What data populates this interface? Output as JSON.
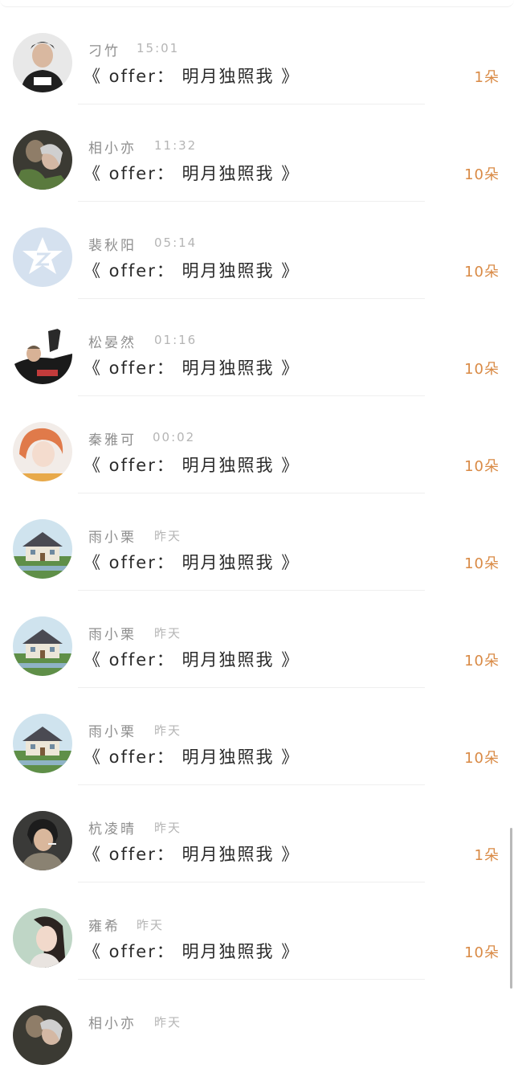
{
  "messages": [
    {
      "name": "刁竹",
      "time": "15:01",
      "title": "《 offer： 明月独照我 》",
      "count": "1朵",
      "avatar": "man-black-tank-icon"
    },
    {
      "name": "相小亦",
      "time": "11:32",
      "title": "《 offer： 明月独照我 》",
      "count": "10朵",
      "avatar": "couple-photo-icon"
    },
    {
      "name": "裴秋阳",
      "time": "05:14",
      "title": "《 offer： 明月独照我 》",
      "count": "10朵",
      "avatar": "qzone-default-icon"
    },
    {
      "name": "松晏然",
      "time": "01:16",
      "title": "《 offer： 明月独照我 》",
      "count": "10朵",
      "avatar": "man-car-icon"
    },
    {
      "name": "秦雅可",
      "time": "00:02",
      "title": "《 offer： 明月独照我 》",
      "count": "10朵",
      "avatar": "girl-light-icon"
    },
    {
      "name": "雨小栗",
      "time": "昨天",
      "title": "《 offer： 明月独照我 》",
      "count": "10朵",
      "avatar": "house-garden-icon"
    },
    {
      "name": "雨小栗",
      "time": "昨天",
      "title": "《 offer： 明月独照我 》",
      "count": "10朵",
      "avatar": "house-garden-icon"
    },
    {
      "name": "雨小栗",
      "time": "昨天",
      "title": "《 offer： 明月独照我 》",
      "count": "10朵",
      "avatar": "house-garden-icon"
    },
    {
      "name": "杭凌晴",
      "time": "昨天",
      "title": "《 offer： 明月独照我 》",
      "count": "1朵",
      "avatar": "person-smoking-icon"
    },
    {
      "name": "雍希",
      "time": "昨天",
      "title": "《 offer： 明月独照我 》",
      "count": "10朵",
      "avatar": "girl-portrait-icon"
    },
    {
      "name": "相小亦",
      "time": "昨天",
      "title": "",
      "count": "",
      "avatar": "couple-photo-icon"
    }
  ]
}
